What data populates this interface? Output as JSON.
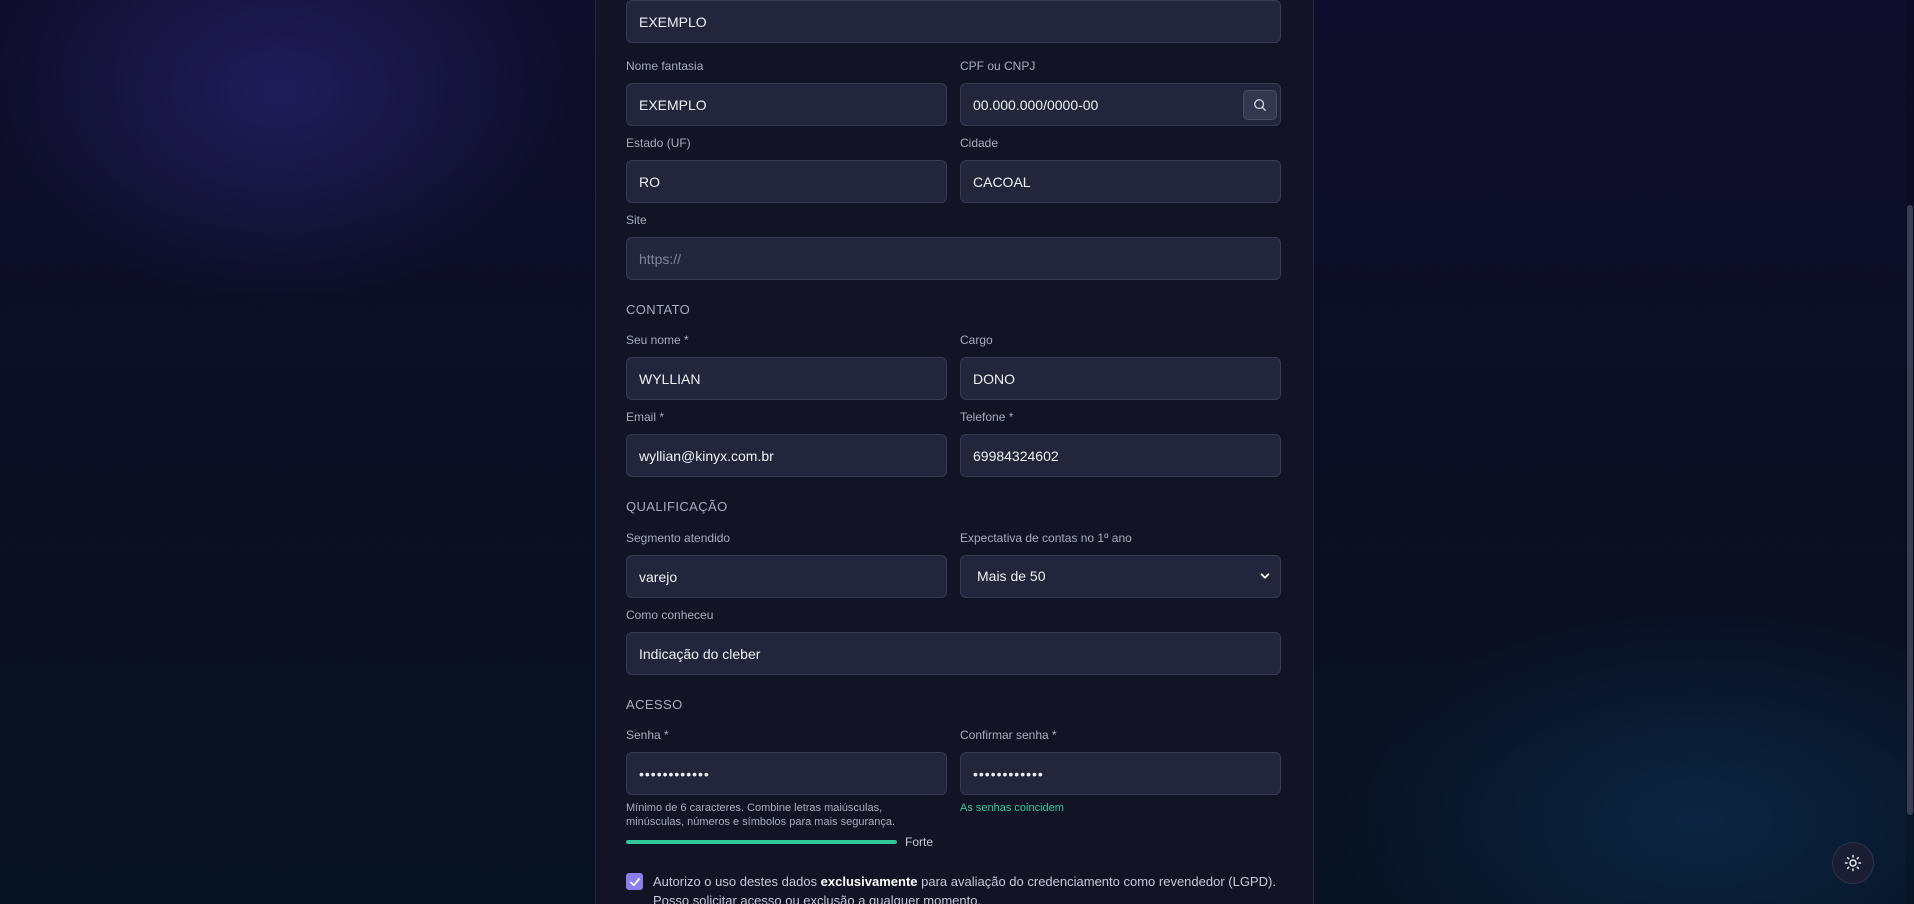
{
  "company": {
    "razao_value": "EXEMPLO",
    "fantasia_label": "Nome fantasia",
    "fantasia_value": "EXEMPLO",
    "cpf_label": "CPF ou CNPJ",
    "cpf_value": "00.000.000/0000-00",
    "uf_label": "Estado (UF)",
    "uf_value": "RO",
    "cidade_label": "Cidade",
    "cidade_value": "CACOAL",
    "site_label": "Site",
    "site_value": "",
    "site_placeholder": "https://"
  },
  "contato": {
    "section_title": "CONTATO",
    "nome_label": "Seu nome *",
    "nome_value": "WYLLIAN",
    "cargo_label": "Cargo",
    "cargo_value": "DONO",
    "email_label": "Email *",
    "email_value": "wyllian@kinyx.com.br",
    "telefone_label": "Telefone *",
    "telefone_value": "69984324602"
  },
  "qualificacao": {
    "section_title": "QUALIFICAÇÃO",
    "segmento_label": "Segmento atendido",
    "segmento_value": "varejo",
    "expectativa_label": "Expectativa de contas no 1º ano",
    "expectativa_selected": "Mais de 50",
    "como_label": "Como conheceu",
    "como_value": "Indicação do cleber"
  },
  "acesso": {
    "section_title": "ACESSO",
    "senha_label": "Senha *",
    "senha_value": "••••••••••••",
    "confirmar_label": "Confirmar senha *",
    "confirmar_value": "••••••••••••",
    "hint": "Mínimo de 6 caracteres. Combine letras maiúsculas, minúsculas, números e símbolos para mais segurança.",
    "match_text": "As senhas coincidem",
    "strength_label": "Forte",
    "strength_value": 1.0
  },
  "consent": {
    "checked": true,
    "text_before": "Autorizo o uso destes dados ",
    "text_bold": "exclusivamente",
    "text_after": " para avaliação do credenciamento como revendedor (LGPD). Posso solicitar acesso ou exclusão a qualquer momento."
  },
  "icons": {
    "search": "search-icon",
    "chevron": "chevron-down-icon",
    "check": "check-icon",
    "theme": "sun-icon"
  },
  "colors": {
    "accent": "#8a80ec",
    "success": "#34c99b",
    "input_bg": "#23253a",
    "card_bg": "#131526"
  }
}
